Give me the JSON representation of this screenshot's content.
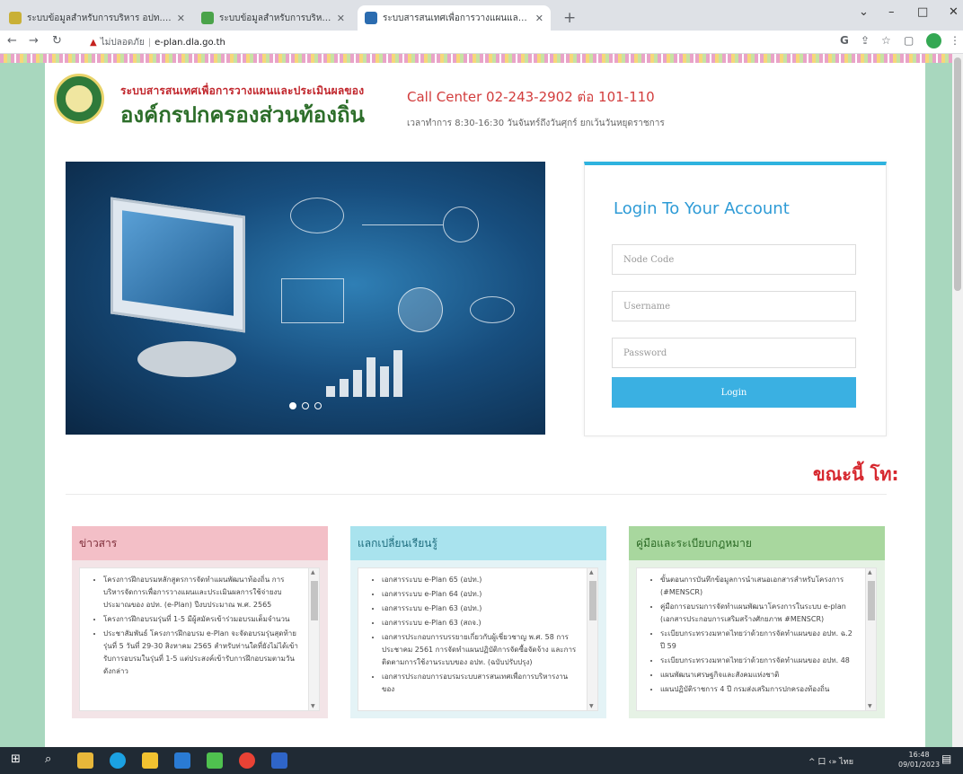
{
  "browser": {
    "tabs": [
      {
        "title": "ระบบข้อมูลสำหรับการบริหาร อปท.ด้านอ...",
        "active": false,
        "favicon_color": "#c9b037"
      },
      {
        "title": "ระบบข้อมูลสำหรับการบริหาร อปท.ด้านอ...",
        "active": false,
        "favicon_color": "#4aa34a"
      },
      {
        "title": "ระบบสารสนเทศเพื่อการวางแผนและประ...",
        "active": true,
        "favicon_color": "#2b6cb0"
      }
    ],
    "new_tab": "+",
    "address": {
      "security_label": "ไม่ปลอดภัย",
      "url": "e-plan.dla.go.th"
    }
  },
  "header": {
    "system_title": "ระบบสารสนเทศเพื่อการวางแผนและประเมินผลของ",
    "org_name": "องค์กรปกครองส่วนท้องถิ่น",
    "call_center": "Call Center 02-243-2902 ต่อ 101-110",
    "office_hours": "เวลาทำการ 8:30-16:30 วันจันทร์ถึงวันศุกร์ ยกเว้นวันหยุดราชการ"
  },
  "carousel": {
    "slide_count": 3,
    "active_slide": 1
  },
  "login": {
    "title": "Login To Your Account",
    "node_code_placeholder": "Node Code",
    "username_placeholder": "Username",
    "password_placeholder": "Password",
    "button_label": "Login"
  },
  "marquee": "ขณะนี้ โท:",
  "panels": {
    "news": {
      "title": "ข่าวสาร",
      "items": [
        "โครงการฝึกอบรมหลักสูตรการจัดทำแผนพัฒนาท้องถิ่น การบริหารจัดการเพื่อการวางแผนและประเมินผลการใช้จ่ายงบประมาณของ อปท. (e-Plan) ปีงบประมาณ พ.ศ. 2565",
        "โครงการฝึกอบรมรุ่นที่ 1-5 มีผู้สมัครเข้าร่วมอบรมเต็มจำนวน",
        "ประชาสัมพันธ์ โครงการฝึกอบรม e-Plan จะจัดอบรมรุ่นสุดท้าย รุ่นที่ 5 วันที่ 29-30 สิงหาคม 2565 สำหรับท่านใดที่ยังไม่ได้เข้ารับการอบรมในรุ่นที่ 1-5 แต่ประสงค์เข้ารับการฝึกอบรมตามวันดังกล่าว"
      ]
    },
    "share": {
      "title": "แลกเปลี่ยนเรียนรู้",
      "items": [
        "เอกสารระบบ e-Plan 65 (อปท.)",
        "เอกสารระบบ e-Plan 64 (อปท.)",
        "เอกสารระบบ e-Plan 63 (อปท.)",
        "เอกสารระบบ e-Plan 63 (สถจ.)",
        "เอกสารประกอบการบรรยายเกี่ยวกับผู้เชี่ยวชาญ พ.ศ. 58 การประชาคม 2561 การจัดทำแผนปฏิบัติการจัดซื้อจัดจ้าง และการติดตามการใช้งานระบบของ อปท. (ฉบับปรับปรุง)",
        "เอกสารประกอบการอบรมระบบสารสนเทศเพื่อการบริหารงานของ"
      ]
    },
    "manual": {
      "title": "คู่มือและระเบียบกฎหมาย",
      "items": [
        "ขั้นตอนการบันทึกข้อมูลการนำเสนอเอกสารสำหรับโครงการ (#MENSCR)",
        "คู่มือการอบรมการจัดทำแผนพัฒนาโครงการในระบบ e-plan (เอกสารประกอบการเสริมสร้างศักยภาพ #MENSCR)",
        "ระเบียบกระทรวงมหาดไทยว่าด้วยการจัดทำแผนของ อปท. ฉ.2 ปี 59",
        "ระเบียบกระทรวงมหาดไทยว่าด้วยการจัดทำแผนของ อปท. 48",
        "แผนพัฒนาเศรษฐกิจและสังคมแห่งชาติ",
        "แผนปฏิบัติราชการ 4 ปี กรมส่งเสริมการปกครองท้องถิ่น"
      ]
    }
  },
  "taskbar": {
    "tray_text": "^ 口 ‹» ไทย",
    "time": "16:48",
    "date": "09/01/2023"
  }
}
